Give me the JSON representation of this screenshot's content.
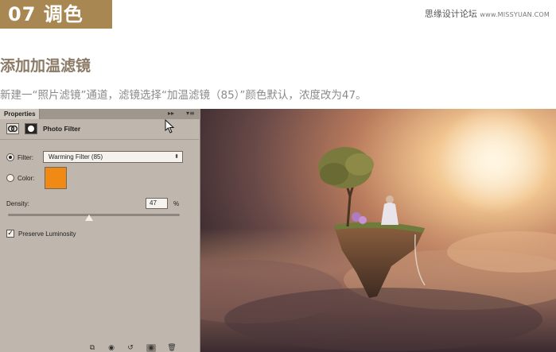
{
  "header": {
    "step": "07 调色",
    "site_name": "思缘设计论坛",
    "site_url": "www.MISSYUAN.COM"
  },
  "section": {
    "title": "添加加温滤镜",
    "description": "新建一“照片滤镜”通道，滤镜选择“加温滤镜（85）”颜色默认，浓度改为47。"
  },
  "panel": {
    "tab_label": "Properties",
    "collapse_glyph": "▸▸",
    "menu_glyph": "▾≡",
    "adjustment_title": "Photo Filter",
    "filter_label": "Filter:",
    "filter_value": "Warming Filter (85)",
    "color_label": "Color:",
    "color_hex": "#f08a14",
    "density_label": "Density:",
    "density_value": "47",
    "density_unit": "%",
    "density_level": 47,
    "preserve_label": "Preserve Luminosity",
    "preserve_checked": true,
    "mode_selected": "filter"
  },
  "colors": {
    "badge": "#a88753",
    "panel_bg": "#bfb7ad",
    "heading": "#8b7a66"
  }
}
